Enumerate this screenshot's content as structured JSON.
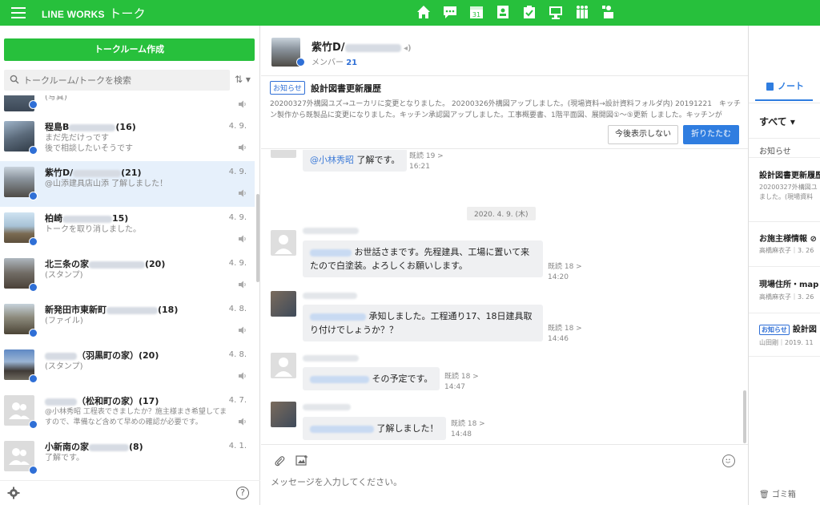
{
  "header": {
    "brand": "LINE WORKS",
    "brand_sub": "トーク",
    "nav": [
      "home-icon",
      "talk-icon",
      "calendar-icon",
      "contacts-icon",
      "task-icon",
      "monitor-icon",
      "people-icon",
      "admin-icon"
    ]
  },
  "left": {
    "create_label": "トークルーム作成",
    "search_placeholder": "トークルーム/トークを検索",
    "items": [
      {
        "title": "",
        "sub": "(写真)",
        "date": ""
      },
      {
        "title": "程島B",
        "count": "(16)",
        "sub": "まだ先だけっです\n後で相談したいそうです",
        "date": "4. 9."
      },
      {
        "title": "紫竹D/",
        "count": "(21)",
        "sub": "@山添建具店山添 了解しました！",
        "date": "4. 9."
      },
      {
        "title": "柏崎",
        "count": "15)",
        "sub": "トークを取り消しました。",
        "date": "4. 9."
      },
      {
        "title": "北三条の家",
        "count": "(20)",
        "sub": "(スタンプ)",
        "date": "4. 9."
      },
      {
        "title": "新発田市東新町",
        "count": "(18)",
        "sub": "(ファイル)",
        "date": "4. 8."
      },
      {
        "title": "",
        "count": "（羽黒町の家）(20)",
        "sub": "(スタンプ)",
        "date": "4. 8."
      },
      {
        "title": "",
        "count": "（松和町の家）(17)",
        "sub": "@小林秀昭 工程表できましたか？施主様まき希望してますので、準備など含めて早めの確認が必要です。",
        "date": "4. 7."
      },
      {
        "title": "小新南の家",
        "count": "(8)",
        "sub": "了解です。",
        "date": "4. 1."
      }
    ]
  },
  "room": {
    "title": "紫竹D/",
    "members_label": "メンバー",
    "members_count": "21",
    "notice_tag": "お知らせ",
    "notice_title": "設計図書更新履歴",
    "notice_body": "20200327外構図ユズ→ユーカリに変更となりました。 20200326外構図アップしました。(現場資料→設計資料フォルダ内) 20191221　キッチン製作から既製品に変更になりました。キッチン承認図アップしました。工事概要書、1階平面図、展開図①～⑤更新 しました。キッチンが",
    "btn_hide": "今後表示しない",
    "btn_fold": "折りたたむ"
  },
  "chat": {
    "date_divider": "2020. 4. 9. (木)",
    "messages": [
      {
        "mention": "@小林秀昭",
        "text": " 了解です。",
        "read": "既読 19 >",
        "time": "16:21"
      },
      {
        "mention": "",
        "text": " お世話さまです。先程建具、工場に置いて来たので白塗装。よろしくお願いします。",
        "read": "既読 18 >",
        "time": "14:20"
      },
      {
        "mention": "",
        "text": " 承知しました。工程通り17、18日建具取り付けでしょうか？？",
        "read": "既読 18 >",
        "time": "14:46"
      },
      {
        "mention": "",
        "text": " その予定です。",
        "read": "既読 18 >",
        "time": "14:47"
      },
      {
        "mention": "",
        "text": " 了解しました！",
        "read": "既読 18 >",
        "time": "14:48"
      }
    ]
  },
  "composer": {
    "placeholder": "メッセージを入力してください。"
  },
  "right": {
    "tab": "ノート",
    "filter": "すべて ▾",
    "section": "お知らせ",
    "notes": [
      {
        "title": "設計図書更新履歴",
        "body": "20200327外構図ユ\nました。(現場資料"
      },
      {
        "title": "お施主様情報 ⊘",
        "body": "高橋麻衣子｜3. 26"
      },
      {
        "title": "現場住所・map",
        "body": "高橋麻衣子｜3. 26"
      },
      {
        "tag": "お知らせ",
        "title": "設計図",
        "body": "山田剛｜2019. 11"
      }
    ],
    "trash": "ゴミ箱"
  },
  "colors": {
    "green": "#27c03c",
    "blue": "#2f7de0"
  }
}
